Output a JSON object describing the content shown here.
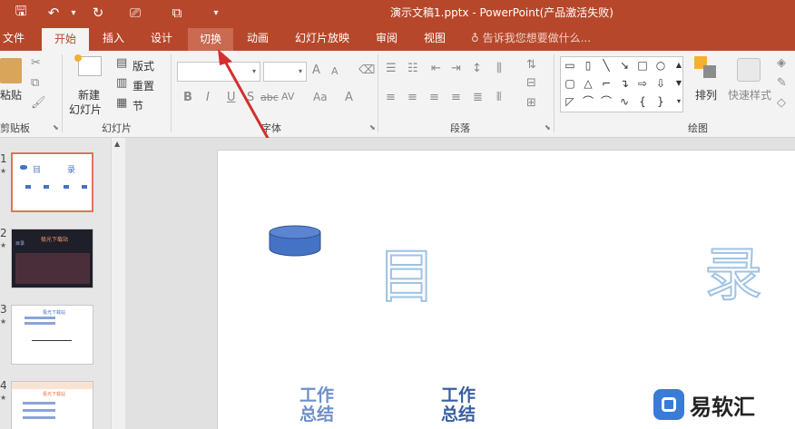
{
  "titlebar": {
    "title": "演示文稿1.pptx - PowerPoint(产品激活失败)",
    "qat": {
      "save": "🖫",
      "undo": "↶",
      "undo_drop": "▾",
      "redo": "↻",
      "present": "⎚",
      "preview": "⧉",
      "more": "▾"
    }
  },
  "tabs": [
    {
      "label": "文件"
    },
    {
      "label": "开始"
    },
    {
      "label": "插入"
    },
    {
      "label": "设计"
    },
    {
      "label": "切换"
    },
    {
      "label": "动画"
    },
    {
      "label": "幻灯片放映"
    },
    {
      "label": "审阅"
    },
    {
      "label": "视图"
    }
  ],
  "tellme": "告诉我您想要做什么...",
  "ribbon": {
    "clipboard": {
      "label": "剪贴板",
      "paste": "粘贴"
    },
    "slides": {
      "label": "幻灯片",
      "new_slide_line1": "新建",
      "new_slide_line2": "幻灯片",
      "layout": "版式",
      "reset": "重置",
      "section": "节"
    },
    "font": {
      "label": "字体",
      "bold": "B",
      "italic": "I",
      "underline": "U",
      "shadow": "S",
      "strike": "abc",
      "spacing": "AV",
      "case": "Aa",
      "color": "A",
      "grow": "A",
      "shrink": "A"
    },
    "paragraph": {
      "label": "段落"
    },
    "drawing": {
      "label": "绘图",
      "arrange": "排列",
      "quick_styles": "快速样式"
    }
  },
  "thumbnails": [
    {
      "num": "1",
      "title_left": "目",
      "title_right": "录"
    },
    {
      "num": "2",
      "header": "极光下载站",
      "sub": "目录"
    },
    {
      "num": "3",
      "header": "极光下载站"
    },
    {
      "num": "4",
      "header": "极光下载站"
    }
  ],
  "slide": {
    "char_left": "目",
    "char_right": "录",
    "items": [
      {
        "line1": "工作",
        "line2": "总结"
      },
      {
        "line1": "工作",
        "line2": "总结"
      }
    ]
  },
  "watermark": {
    "text": "易软汇"
  },
  "colors": {
    "accent": "#b7472a",
    "ribbon_bg": "#f3f3f3",
    "shape_blue": "#4472c4",
    "outline_blue": "#9ec3e4",
    "arrow_red": "#d32f2f"
  }
}
